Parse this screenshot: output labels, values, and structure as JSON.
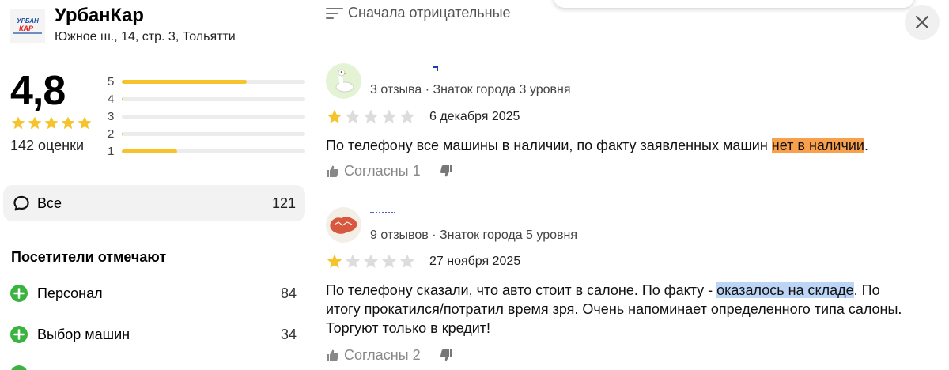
{
  "organization": {
    "logo_text_top": "УРБАН",
    "logo_text_bottom": "КАР",
    "name": "УрбанКар",
    "address": "Южное ш., 14, стр. 3, Тольятти"
  },
  "rating": {
    "value": "4,8",
    "stars_filled": 5,
    "count_label": "142 оценки",
    "distribution": [
      {
        "stars": "5",
        "fraction": 0.68
      },
      {
        "stars": "4",
        "fraction": 0.01
      },
      {
        "stars": "3",
        "fraction": 0.0
      },
      {
        "stars": "2",
        "fraction": 0.01
      },
      {
        "stars": "1",
        "fraction": 0.3
      }
    ]
  },
  "filter": {
    "all_label": "Все",
    "all_count": "121"
  },
  "visitors": {
    "title": "Посетители отмечают",
    "aspects": [
      {
        "label": "Персонал",
        "count": "84"
      },
      {
        "label": "Выбор машин",
        "count": "34"
      }
    ]
  },
  "sort": {
    "label": "Сначала отрицательные"
  },
  "reviews": [
    {
      "author_meta": "3 отзыва · Знаток города 3 уровня",
      "stars_filled": 1,
      "date": "6 декабря 2025",
      "text_before": "По телефону все машины в наличии, по факту заявленных машин ",
      "text_highlight": "нет в наличии",
      "text_after": ".",
      "agree_label": "Согласны 1",
      "avatar": "goose-avatar"
    },
    {
      "author_meta": "9 отзывов · Знаток города 5 уровня",
      "stars_filled": 1,
      "date": "27 ноября 2025",
      "text_before": "По телефону сказали, что авто стоит в салоне. По факту - ",
      "text_highlight": "оказалось на складе",
      "text_after": ". По итогу прокатился/потратил время зря. Очень напоминает определенного типа салоны. Торгуют только в кредит!",
      "agree_label": "Согласны 2",
      "avatar": "map-avatar"
    }
  ],
  "colors": {
    "star": "#f6c32a",
    "star_empty": "#dcdcdc",
    "plus_green": "#3bb43f",
    "highlight_orange": "#f9a04d",
    "highlight_blue": "#bcd4f5"
  }
}
